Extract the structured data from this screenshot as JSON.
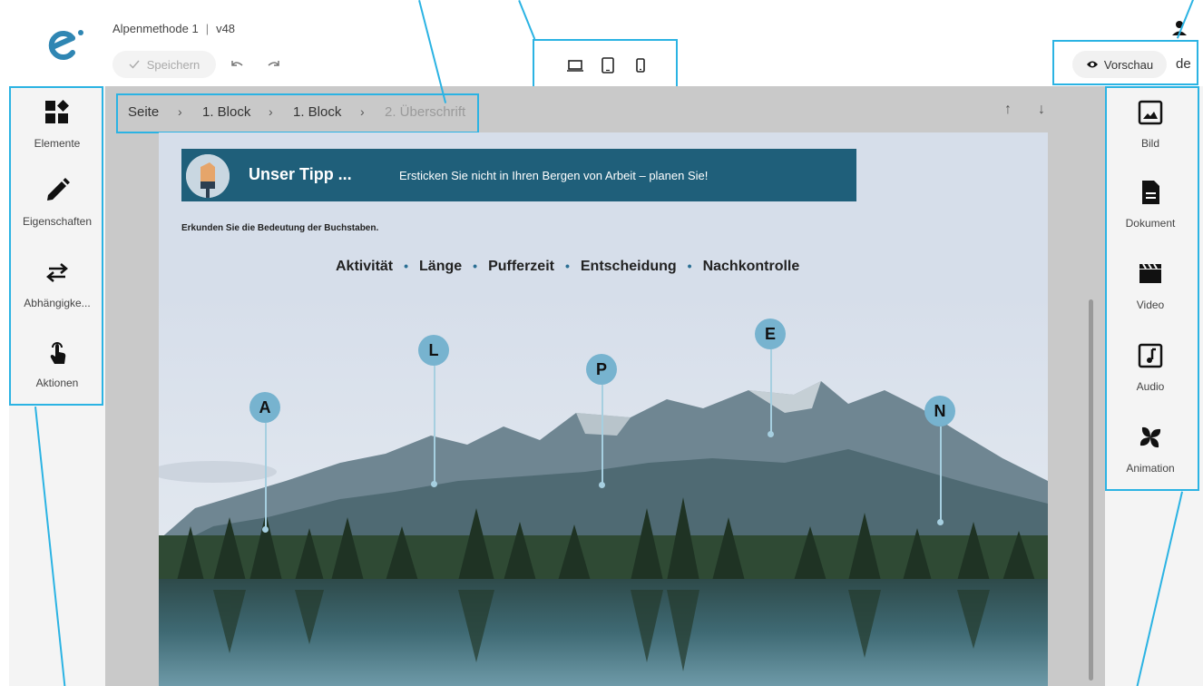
{
  "header": {
    "doc_name": "Alpenmethode 1",
    "separator": "|",
    "version": "v48",
    "save_label": "Speichern",
    "preview_label": "Vorschau",
    "language": "de"
  },
  "left_sidebar": {
    "items": [
      {
        "label": "Elemente",
        "icon": "widgets-icon"
      },
      {
        "label": "Eigenschaften",
        "icon": "pencil-icon"
      },
      {
        "label": "Abhängigke...",
        "icon": "swap-arrows-icon"
      },
      {
        "label": "Aktionen",
        "icon": "touch-hand-icon"
      }
    ]
  },
  "right_sidebar": {
    "items": [
      {
        "label": "Bild",
        "icon": "image-icon"
      },
      {
        "label": "Dokument",
        "icon": "document-icon"
      },
      {
        "label": "Video",
        "icon": "clapperboard-icon"
      },
      {
        "label": "Audio",
        "icon": "music-note-icon"
      },
      {
        "label": "Animation",
        "icon": "pinwheel-icon"
      }
    ]
  },
  "breadcrumb": {
    "items": [
      "Seite",
      "1. Block",
      "1. Block",
      "2. Überschrift"
    ],
    "sep": "›"
  },
  "content": {
    "tip_title": "Unser Tipp ...",
    "tip_text": "Ersticken Sie nicht in Ihren Bergen von Arbeit – planen Sie!",
    "intro": "Erkunden Sie die Bedeutung der Buchstaben.",
    "legend": [
      "Aktivität",
      "Länge",
      "Pufferzeit",
      "Entscheidung",
      "Nachkontrolle"
    ],
    "legend_dot": "•",
    "pins": [
      "A",
      "L",
      "P",
      "E",
      "N"
    ]
  },
  "colors": {
    "accent": "#2bb3e3",
    "banner": "#1f5f7a",
    "pin": "#77b3cf"
  }
}
